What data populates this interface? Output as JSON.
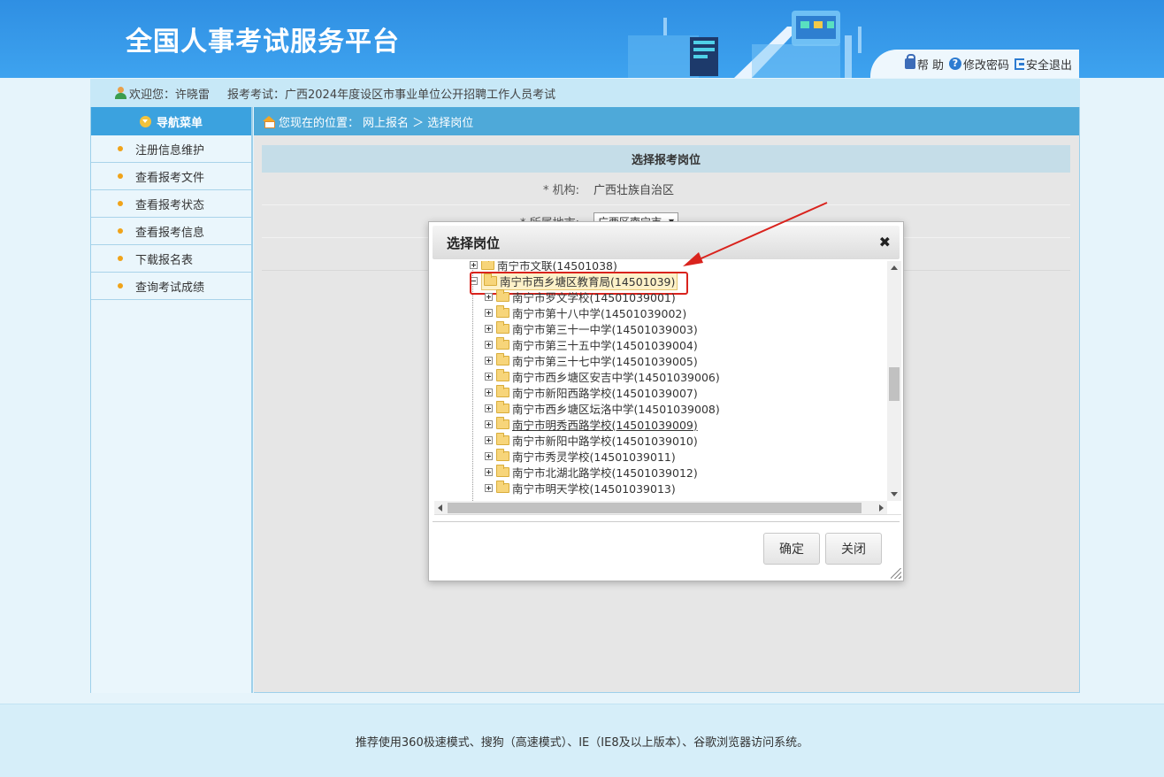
{
  "header": {
    "title": "全国人事考试服务平台",
    "links": [
      {
        "label": "帮 助",
        "icon": "lock-icon"
      },
      {
        "label": "修改密码",
        "icon": "help-icon"
      },
      {
        "label": "安全退出",
        "icon": "exit-icon"
      }
    ]
  },
  "welcome": {
    "greeting": "欢迎您：许晓雷",
    "exam": "报考考试：广西2024年度设区市事业单位公开招聘工作人员考试"
  },
  "sidebar": {
    "title": "导航菜单",
    "items": [
      {
        "label": "注册信息维护"
      },
      {
        "label": "查看报考文件"
      },
      {
        "label": "查看报考状态"
      },
      {
        "label": "查看报考信息"
      },
      {
        "label": "下载报名表"
      },
      {
        "label": "查询考试成绩"
      }
    ]
  },
  "breadcrumb": {
    "prefix": "您现在的位置：",
    "path": "网上报名 ＞ 选择岗位"
  },
  "form": {
    "title": "选择报考岗位",
    "org_label": "* 机构:",
    "org_value": "广西壮族自治区",
    "region_label": "* 所属地市:",
    "region_value": "广西区南宁市"
  },
  "modal": {
    "title": "选择岗位",
    "close": "✖",
    "tree": [
      {
        "label": "南宁市文联(14501038)",
        "level": 0,
        "expanded": false
      },
      {
        "label": "南宁市西乡塘区教育局(14501039)",
        "level": 0,
        "expanded": true,
        "selected": true
      },
      {
        "label": "南宁市罗文学校(14501039001)",
        "level": 1
      },
      {
        "label": "南宁市第十八中学(14501039002)",
        "level": 1
      },
      {
        "label": "南宁市第三十一中学(14501039003)",
        "level": 1
      },
      {
        "label": "南宁市第三十五中学(14501039004)",
        "level": 1
      },
      {
        "label": "南宁市第三十七中学(14501039005)",
        "level": 1
      },
      {
        "label": "南宁市西乡塘区安吉中学(14501039006)",
        "level": 1
      },
      {
        "label": "南宁市新阳西路学校(14501039007)",
        "level": 1
      },
      {
        "label": "南宁市西乡塘区坛洛中学(14501039008)",
        "level": 1
      },
      {
        "label": "南宁市明秀西路学校(14501039009)",
        "level": 1,
        "underline": true
      },
      {
        "label": "南宁市新阳中路学校(14501039010)",
        "level": 1
      },
      {
        "label": "南宁市秀灵学校(14501039011)",
        "level": 1
      },
      {
        "label": "南宁市北湖北路学校(14501039012)",
        "level": 1
      },
      {
        "label": "南宁市明天学校(14501039013)",
        "level": 1
      }
    ],
    "ok_label": "确定",
    "cancel_label": "关闭"
  },
  "footer": {
    "text": "推荐使用360极速模式、搜狗（高速模式）、IE（IE8及以上版本）、谷歌浏览器访问系统。"
  },
  "colors": {
    "header": "#3ea3ef",
    "nav_head": "#3ba2df",
    "annotation": "#d9231d"
  }
}
